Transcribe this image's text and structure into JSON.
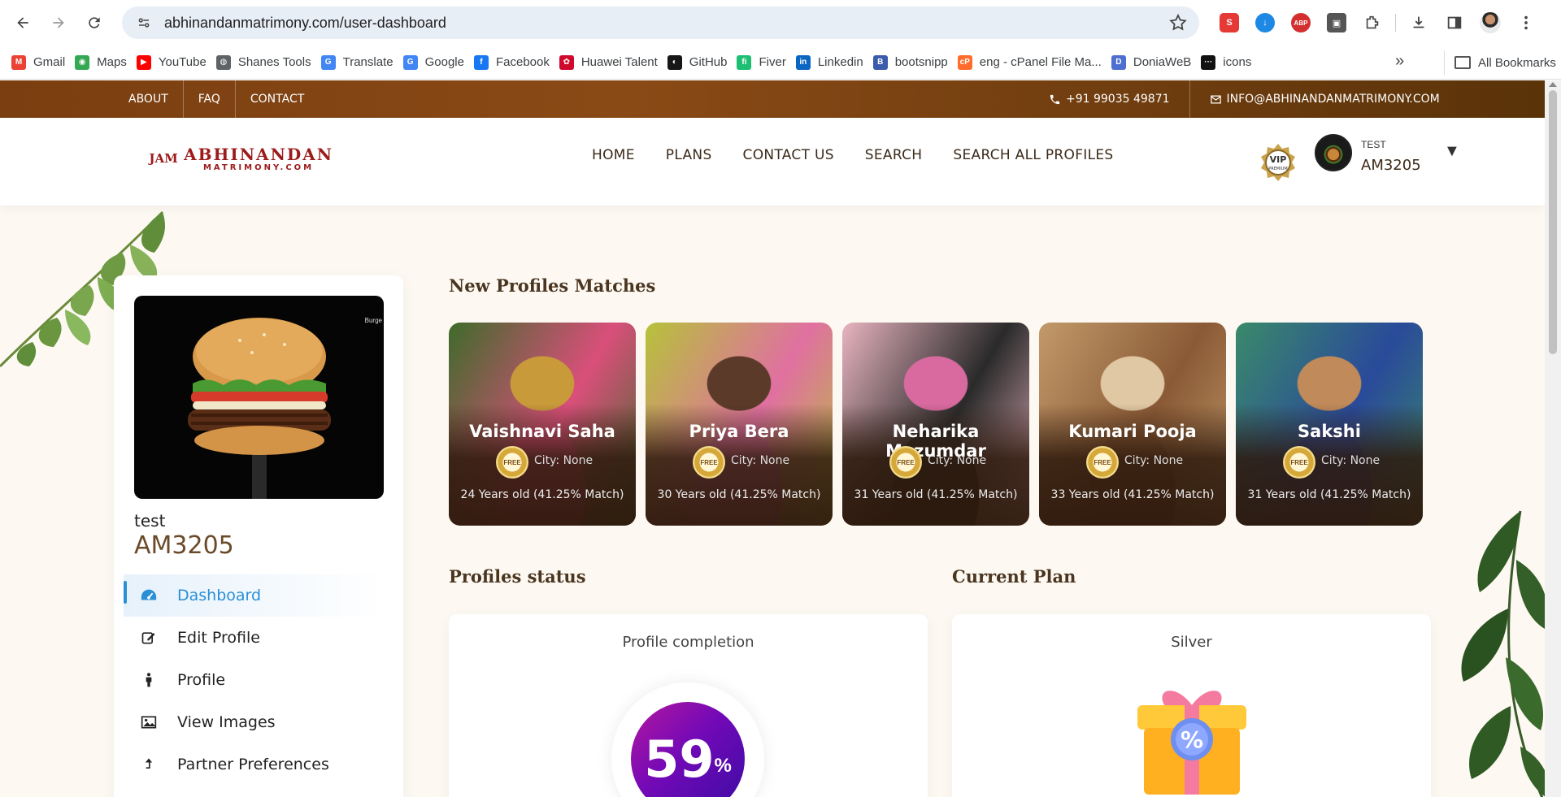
{
  "browser": {
    "url": "abhinandanmatrimony.com/user-dashboard",
    "bookmarks": [
      {
        "label": "Gmail",
        "icon": "gmail-icon",
        "color": "#ea4335"
      },
      {
        "label": "Maps",
        "icon": "maps-icon",
        "color": "#34a853"
      },
      {
        "label": "YouTube",
        "icon": "youtube-icon",
        "color": "#ff0000"
      },
      {
        "label": "Shanes Tools",
        "icon": "globe-icon",
        "color": "#5f6368"
      },
      {
        "label": "Translate",
        "icon": "translate-icon",
        "color": "#4285f4"
      },
      {
        "label": "Google",
        "icon": "google-icon",
        "color": "#4285f4"
      },
      {
        "label": "Facebook",
        "icon": "facebook-icon",
        "color": "#1877f2"
      },
      {
        "label": "Huawei Talent",
        "icon": "huawei-icon",
        "color": "#cf0a2c"
      },
      {
        "label": "GitHub",
        "icon": "github-icon",
        "color": "#181717"
      },
      {
        "label": "Fiver",
        "icon": "fiverr-icon",
        "color": "#1dbf73"
      },
      {
        "label": "Linkedin",
        "icon": "linkedin-icon",
        "color": "#0a66c2"
      },
      {
        "label": "bootsnipp",
        "icon": "bootsnipp-icon",
        "color": "#3b5bab"
      },
      {
        "label": "eng - cPanel File Ma...",
        "icon": "cpanel-icon",
        "color": "#ff6c2c"
      },
      {
        "label": "DoniaWeB",
        "icon": "doniaweb-icon",
        "color": "#4f6fd0"
      },
      {
        "label": "icons",
        "icon": "icons-icon",
        "color": "#111111"
      }
    ],
    "all_bookmarks": "All Bookmarks"
  },
  "topbar": {
    "links": [
      "ABOUT",
      "FAQ",
      "CONTACT"
    ],
    "phone": "+91 99035 49871",
    "email": "INFO@ABHINANDANMATRIMONY.COM"
  },
  "header": {
    "logo_title": "ABHINANDAN",
    "logo_sub": "MATRIMONY.COM",
    "logo_mark": "JAM",
    "nav": [
      "HOME",
      "PLANS",
      "CONTACT US",
      "SEARCH",
      "SEARCH ALL PROFILES"
    ],
    "vip_badge": "VIP",
    "vip_sub": "PREMIUM",
    "user_label": "TEST",
    "user_id": "AM3205"
  },
  "sidebar": {
    "photo_tag": "Burge",
    "name": "test",
    "id": "AM3205",
    "menu": [
      {
        "label": "Dashboard",
        "icon": "dashboard-icon",
        "active": true
      },
      {
        "label": "Edit Profile",
        "icon": "edit-icon",
        "active": false
      },
      {
        "label": "Profile",
        "icon": "person-icon",
        "active": false
      },
      {
        "label": "View Images",
        "icon": "image-icon",
        "active": false
      },
      {
        "label": "Partner Preferences",
        "icon": "upload-icon",
        "active": false
      }
    ]
  },
  "matches": {
    "title": "New Profiles Matches",
    "profiles": [
      {
        "name": "Vaishnavi Saha",
        "city": "City: None",
        "age": "24 Years old  (41.25% Match)",
        "palette": [
          "#3e6b2a",
          "#d94f7a",
          "#c99a3a"
        ]
      },
      {
        "name": "Priya Bera",
        "city": "City: None",
        "age": "30 Years old  (41.25% Match)",
        "palette": [
          "#b6c23a",
          "#e070a0",
          "#5c3a2a"
        ]
      },
      {
        "name": "Neharika Mazumdar",
        "city": "City: None",
        "age": "31 Years old  (41.25% Match)",
        "palette": [
          "#e8b4c0",
          "#2a2a2a",
          "#d86aa0"
        ]
      },
      {
        "name": "Kumari Pooja",
        "city": "City: None",
        "age": "33 Years old  (41.25% Match)",
        "palette": [
          "#c29a6a",
          "#8a5a36",
          "#e0c8a4"
        ]
      },
      {
        "name": "Sakshi",
        "city": "City: None",
        "age": "31 Years old  (41.25% Match)",
        "palette": [
          "#3a8a6a",
          "#2a4a9a",
          "#c08a5a"
        ]
      }
    ],
    "badge_text": "FREE"
  },
  "status": {
    "title": "Profiles status",
    "card_label": "Profile completion",
    "percent_value": "59",
    "percent_sign": "%"
  },
  "plan": {
    "title": "Current Plan",
    "name": "Silver"
  }
}
